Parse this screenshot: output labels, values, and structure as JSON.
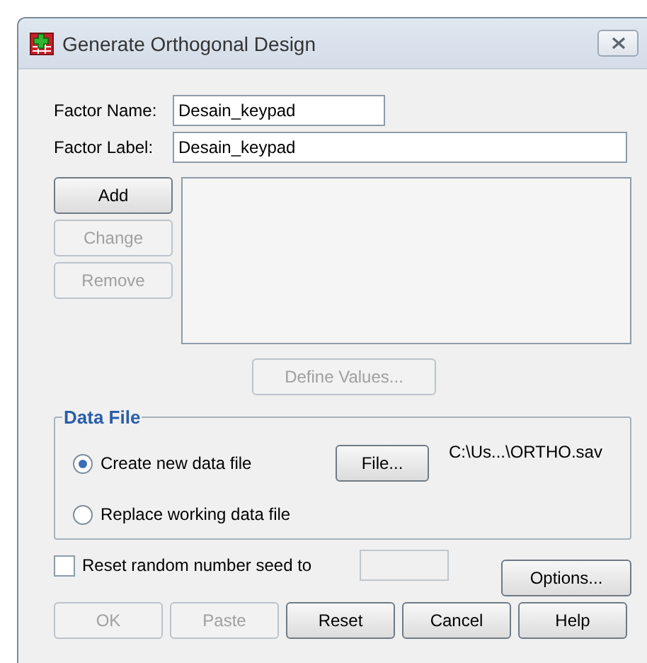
{
  "window": {
    "title": "Generate Orthogonal Design"
  },
  "factor_name": {
    "label": "Factor Name:",
    "value": "Desain_keypad"
  },
  "factor_label": {
    "label": "Factor Label:",
    "value": "Desain_keypad"
  },
  "factor_buttons": [
    {
      "label": "Add",
      "disabled": false
    },
    {
      "label": "Change",
      "disabled": true
    },
    {
      "label": "Remove",
      "disabled": true
    }
  ],
  "define_values": {
    "label": "Define Values...",
    "disabled": true
  },
  "data_file": {
    "title": "Data File",
    "options": [
      {
        "label": "Create new data file",
        "selected": true
      },
      {
        "label": "Replace working data file",
        "selected": false
      }
    ],
    "file_button": "File...",
    "path": "C:\\Us...\\ORTHO.sav"
  },
  "seed": {
    "label": "Reset random number seed to",
    "checked": false
  },
  "options_button": "Options...",
  "buttons": [
    {
      "label": "OK",
      "disabled": true
    },
    {
      "label": "Paste",
      "disabled": true
    },
    {
      "label": "Reset",
      "disabled": false
    },
    {
      "label": "Cancel",
      "disabled": false
    },
    {
      "label": "Help",
      "disabled": false
    }
  ]
}
